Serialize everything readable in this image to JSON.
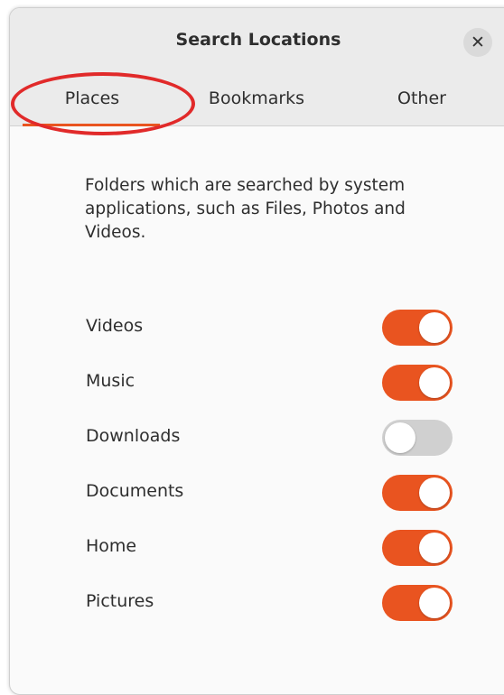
{
  "window": {
    "title": "Search Locations",
    "close_icon": "close-icon",
    "close_glyph": "✕"
  },
  "tabs": [
    {
      "label": "Places",
      "selected": true
    },
    {
      "label": "Bookmarks",
      "selected": false
    },
    {
      "label": "Other",
      "selected": false
    }
  ],
  "places": {
    "description": "Folders which are searched by system applications, such as Files, Photos and Videos.",
    "items": [
      {
        "label": "Videos",
        "enabled": true
      },
      {
        "label": "Music",
        "enabled": true
      },
      {
        "label": "Downloads",
        "enabled": false
      },
      {
        "label": "Documents",
        "enabled": true
      },
      {
        "label": "Home",
        "enabled": true
      },
      {
        "label": "Pictures",
        "enabled": true
      }
    ]
  },
  "colors": {
    "accent": "#e95420",
    "toggle_off": "#d0d0d0",
    "annotation_circle": "#e12a2a"
  }
}
